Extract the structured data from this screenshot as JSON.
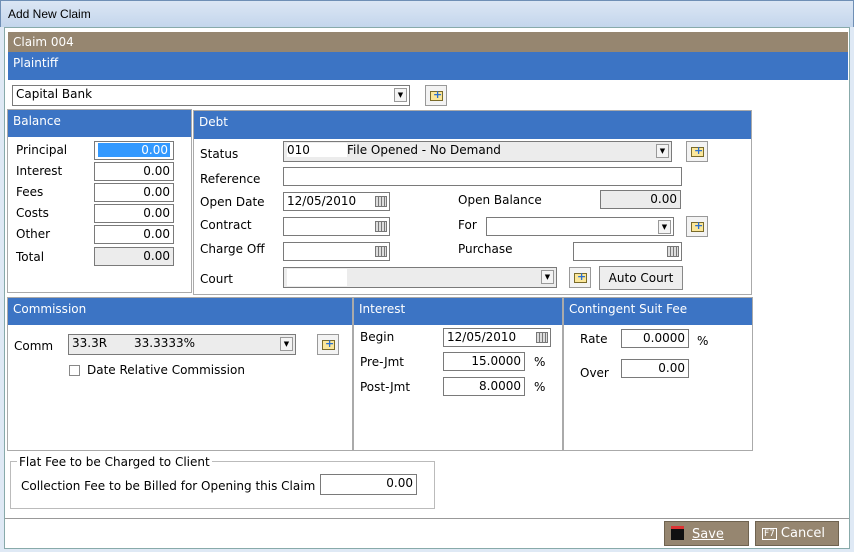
{
  "window": {
    "title": "Add New Claim"
  },
  "claim": {
    "title": "Claim 004"
  },
  "plaintiff": {
    "header": "Plaintiff",
    "value": "Capital Bank"
  },
  "balance": {
    "header": "Balance",
    "rows": [
      {
        "label": "Principal",
        "value": "0.00"
      },
      {
        "label": "Interest",
        "value": "0.00"
      },
      {
        "label": "Fees",
        "value": "0.00"
      },
      {
        "label": "Costs",
        "value": "0.00"
      },
      {
        "label": "Other",
        "value": "0.00"
      },
      {
        "label": "Total",
        "value": "0.00"
      }
    ]
  },
  "debt": {
    "header": "Debt",
    "status_label": "Status",
    "status_code": "010",
    "status_desc": "File Opened - No Demand",
    "reference_label": "Reference",
    "reference": "",
    "open_date_label": "Open Date",
    "open_date": "12/05/2010",
    "open_balance_label": "Open Balance",
    "open_balance": "0.00",
    "contract_label": "Contract",
    "contract": "",
    "for_label": "For",
    "for": "",
    "charge_off_label": "Charge Off",
    "charge_off": "",
    "purchase_label": "Purchase",
    "purchase": "",
    "court_label": "Court",
    "court": "",
    "auto_court": "Auto Court"
  },
  "commission": {
    "header": "Commission",
    "comm_label": "Comm",
    "comm_code": "33.3R",
    "comm_pct": "33.3333%",
    "date_relative": "Date Relative Commission",
    "date_relative_checked": false
  },
  "interest": {
    "header": "Interest",
    "begin_label": "Begin",
    "begin": "12/05/2010",
    "pre_label": "Pre-Jmt",
    "pre": "15.0000",
    "post_label": "Post-Jmt",
    "post": "8.0000",
    "pct": "%"
  },
  "contingent": {
    "header": "Contingent Suit Fee",
    "rate_label": "Rate",
    "rate": "0.0000",
    "pct": "%",
    "over_label": "Over",
    "over": "0.00"
  },
  "flat_fee": {
    "legend": "Flat Fee to be Charged to Client",
    "label": "Collection Fee to be Billed for Opening this Claim",
    "value": "0.00"
  },
  "footer": {
    "save": "Save",
    "cancel": "Cancel",
    "cancel_key": "F7"
  }
}
